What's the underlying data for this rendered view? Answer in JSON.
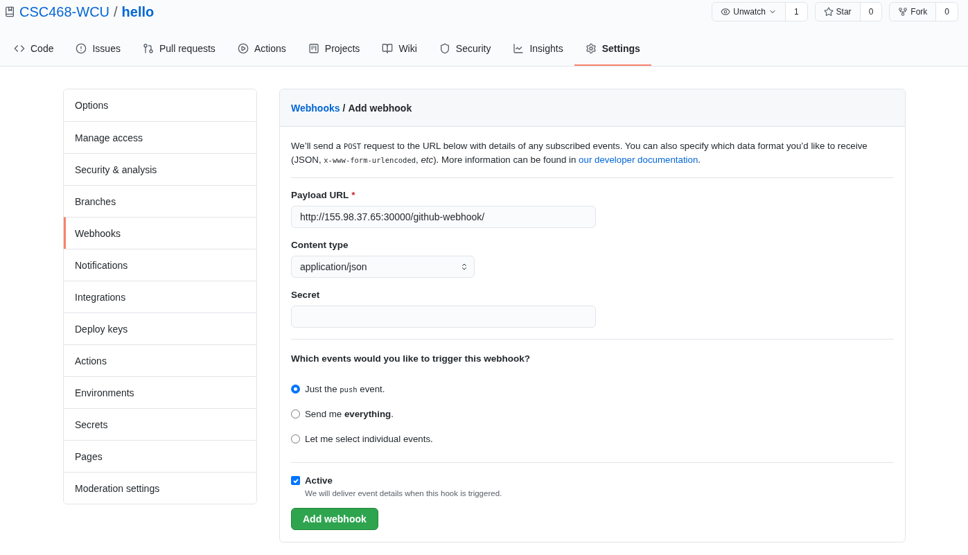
{
  "repo": {
    "owner": "CSC468-WCU",
    "separator": "/",
    "name": "hello"
  },
  "repo_actions": [
    {
      "kind": "watch",
      "label": "Unwatch",
      "count": "1"
    },
    {
      "kind": "star",
      "label": "Star",
      "count": "0"
    },
    {
      "kind": "fork",
      "label": "Fork",
      "count": "0"
    }
  ],
  "tabs": [
    {
      "kind": "code",
      "label": "Code",
      "selected": false
    },
    {
      "kind": "issues",
      "label": "Issues",
      "selected": false
    },
    {
      "kind": "pulls",
      "label": "Pull requests",
      "selected": false
    },
    {
      "kind": "actions",
      "label": "Actions",
      "selected": false
    },
    {
      "kind": "projects",
      "label": "Projects",
      "selected": false
    },
    {
      "kind": "wiki",
      "label": "Wiki",
      "selected": false
    },
    {
      "kind": "security",
      "label": "Security",
      "selected": false
    },
    {
      "kind": "insights",
      "label": "Insights",
      "selected": false
    },
    {
      "kind": "settings",
      "label": "Settings",
      "selected": true
    }
  ],
  "sidebar": {
    "items": [
      {
        "label": "Options",
        "selected": false
      },
      {
        "label": "Manage access",
        "selected": false
      },
      {
        "label": "Security & analysis",
        "selected": false
      },
      {
        "label": "Branches",
        "selected": false
      },
      {
        "label": "Webhooks",
        "selected": true
      },
      {
        "label": "Notifications",
        "selected": false
      },
      {
        "label": "Integrations",
        "selected": false
      },
      {
        "label": "Deploy keys",
        "selected": false
      },
      {
        "label": "Actions",
        "selected": false
      },
      {
        "label": "Environments",
        "selected": false
      },
      {
        "label": "Secrets",
        "selected": false
      },
      {
        "label": "Pages",
        "selected": false
      },
      {
        "label": "Moderation settings",
        "selected": false
      }
    ]
  },
  "breadcrumb": {
    "link": "Webhooks",
    "separator": "/",
    "current": "Add webhook"
  },
  "intro": [
    {
      "kind": "text",
      "text": "We’ll send a "
    },
    {
      "kind": "code",
      "text": "POST"
    },
    {
      "kind": "text",
      "text": " request to the URL below with details of any subscribed events. You can also specify which data format you’d like to receive (JSON, "
    },
    {
      "kind": "code",
      "text": "x-www-form-urlencoded"
    },
    {
      "kind": "text",
      "text": ", "
    },
    {
      "kind": "italic",
      "text": "etc"
    },
    {
      "kind": "text",
      "text": "). More information can be found in "
    },
    {
      "kind": "link",
      "text": "our developer documentation"
    },
    {
      "kind": "text",
      "text": "."
    }
  ],
  "payload_url": {
    "label": "Payload URL",
    "required_mark": "*",
    "value": "http://155.98.37.65:30000/github-webhook/"
  },
  "content_type": {
    "label": "Content type",
    "value": "application/json"
  },
  "secret": {
    "label": "Secret"
  },
  "events": {
    "question": "Which events would you like to trigger this webhook?",
    "options": [
      {
        "selected": true,
        "parts": [
          {
            "kind": "text",
            "text": "Just the "
          },
          {
            "kind": "code",
            "text": "push"
          },
          {
            "kind": "text",
            "text": " event."
          }
        ]
      },
      {
        "selected": false,
        "parts": [
          {
            "kind": "text",
            "text": "Send me "
          },
          {
            "kind": "bold",
            "text": "everything"
          },
          {
            "kind": "text",
            "text": "."
          }
        ]
      },
      {
        "selected": false,
        "parts": [
          {
            "kind": "text",
            "text": "Let me select individual events."
          }
        ]
      }
    ]
  },
  "active": {
    "label": "Active",
    "checked": true,
    "note": "We will deliver event details when this hook is triggered."
  },
  "submit": "Add webhook"
}
